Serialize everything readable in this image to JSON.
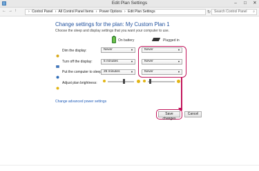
{
  "window": {
    "title": "Edit Plan Settings",
    "controls": [
      "–",
      "□",
      "✕"
    ]
  },
  "address": {
    "back": "←",
    "forward": "→",
    "up": "↑",
    "breadcrumbs": [
      "Control Panel",
      "All Control Panel Items",
      "Power Options",
      "Edit Plan Settings"
    ],
    "separator": "›",
    "refresh": "↻",
    "search_placeholder": "Search Control Panel"
  },
  "main": {
    "heading": "Change settings for the plan: My Custom Plan 1",
    "subheading": "Choose the sleep and display settings that you want your computer to use.",
    "columns": {
      "battery": "On battery",
      "plugged": "Plugged in"
    },
    "rows": [
      {
        "label": "Dim the display:",
        "battery": "Never",
        "plugged": "Never"
      },
      {
        "label": "Turn off the display:",
        "battery": "5 minutes",
        "plugged": "Never"
      },
      {
        "label": "Put the computer to sleep:",
        "battery": "25 minutes",
        "plugged": "Never"
      }
    ],
    "brightness_label": "Adjust plan brightness:",
    "brightness": {
      "battery": 0.6,
      "plugged": 0.05
    },
    "advanced_link": "Change advanced power settings",
    "save_label": "Save changes",
    "cancel_label": "Cancel"
  },
  "colors": {
    "accent": "#c1145a",
    "heading": "#1e4f9c",
    "link": "#1e5bb8"
  }
}
